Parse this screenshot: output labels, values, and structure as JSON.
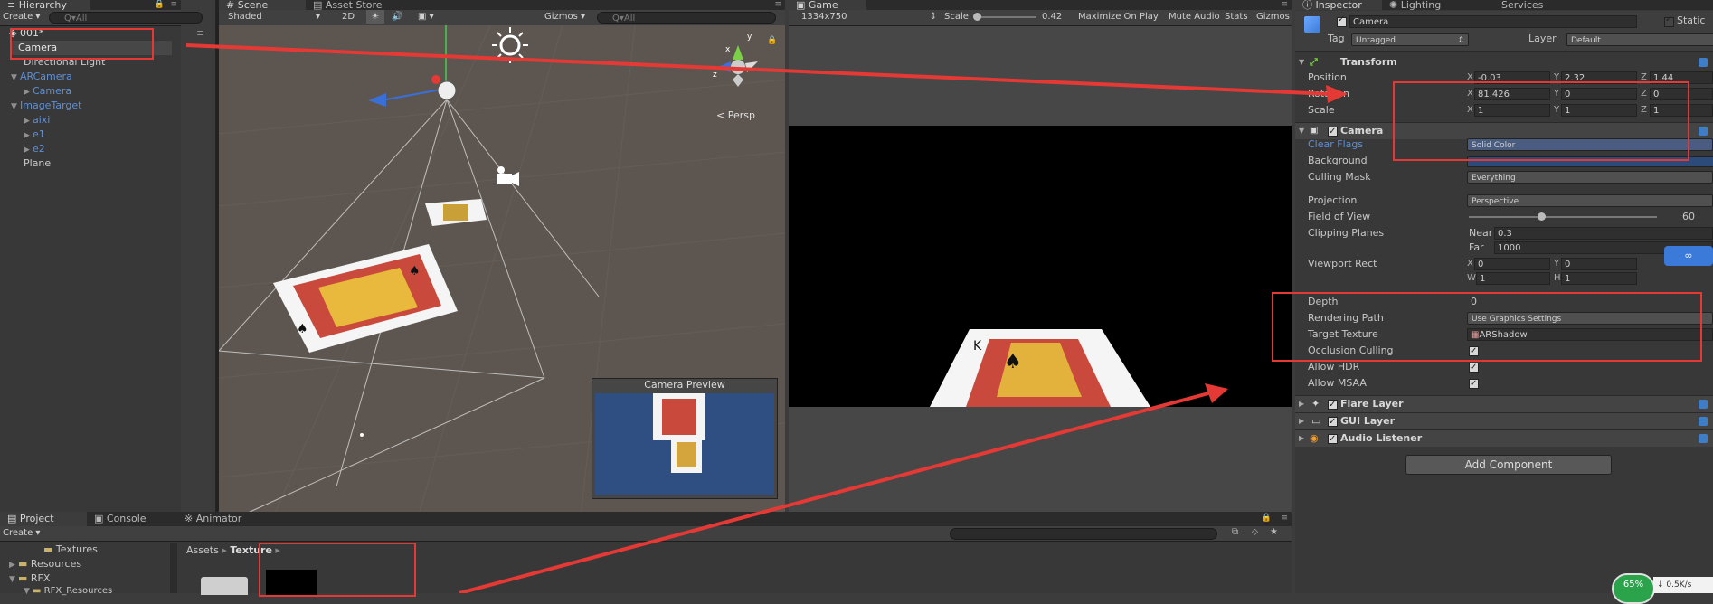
{
  "hierarchy": {
    "tab": "Hierarchy",
    "create": "Create",
    "search_placeholder": "Q▾All",
    "scene_name": "001*",
    "items": [
      {
        "label": "Camera",
        "indent": 1,
        "color": "white",
        "expand": ""
      },
      {
        "label": "Directional Light",
        "indent": 1,
        "color": "white",
        "expand": ""
      },
      {
        "label": "ARCamera",
        "indent": 0,
        "color": "blue",
        "expand": "▼"
      },
      {
        "label": "Camera",
        "indent": 1,
        "color": "blue",
        "expand": "▶"
      },
      {
        "label": "ImageTarget",
        "indent": 0,
        "color": "blue",
        "expand": "▼"
      },
      {
        "label": "aixi",
        "indent": 1,
        "color": "blue",
        "expand": "▶"
      },
      {
        "label": "e1",
        "indent": 1,
        "color": "blue",
        "expand": "▶"
      },
      {
        "label": "e2",
        "indent": 1,
        "color": "blue",
        "expand": "▶"
      },
      {
        "label": "Plane",
        "indent": 1,
        "color": "white",
        "expand": ""
      }
    ]
  },
  "scene": {
    "tabs": [
      "Scene",
      "Asset Store"
    ],
    "shading": "Shaded",
    "mode_2d": "2D",
    "gizmos": "Gizmos",
    "search_placeholder": "Q▾All",
    "persp": "Persp",
    "camera_preview": "Camera Preview",
    "gizmo_axes": [
      "y",
      "x",
      "z"
    ]
  },
  "game": {
    "tab": "Game",
    "resolution": "1334x750",
    "scale_label": "Scale",
    "scale_value": "0.42",
    "maximize": "Maximize On Play",
    "mute": "Mute Audio",
    "stats": "Stats",
    "gizmos": "Gizmos"
  },
  "inspector": {
    "tabs": [
      "Inspector",
      "Lighting",
      "Services"
    ],
    "object_name": "Camera",
    "static_label": "Static",
    "tag_label": "Tag",
    "tag_value": "Untagged",
    "layer_label": "Layer",
    "layer_value": "Default",
    "transform": {
      "title": "Transform",
      "position_label": "Position",
      "rotation_label": "Rotation",
      "scale_label": "Scale",
      "position": {
        "x": "-0.03",
        "y": "2.32",
        "z": "1.44"
      },
      "rotation": {
        "x": "81.426",
        "y": "0",
        "z": "0"
      },
      "scale": {
        "x": "1",
        "y": "1",
        "z": "1"
      }
    },
    "camera": {
      "title": "Camera",
      "clear_flags_label": "Clear Flags",
      "clear_flags_value": "Solid Color",
      "background_label": "Background",
      "background_color": "#2c4a7a",
      "culling_label": "Culling Mask",
      "culling_value": "Everything",
      "projection_label": "Projection",
      "projection_value": "Perspective",
      "fov_label": "Field of View",
      "fov_value": "60",
      "clipping_label": "Clipping Planes",
      "near_label": "Near",
      "near_value": "0.3",
      "far_label": "Far",
      "far_value": "1000",
      "viewport_label": "Viewport Rect",
      "viewport": {
        "x": "0",
        "y": "0",
        "w": "1",
        "h": "1"
      },
      "depth_label": "Depth",
      "depth_value": "0",
      "rendering_label": "Rendering Path",
      "rendering_value": "Use Graphics Settings",
      "target_label": "Target Texture",
      "target_value": "ARShadow",
      "occlusion_label": "Occlusion Culling",
      "hdr_label": "Allow HDR",
      "msaa_label": "Allow MSAA"
    },
    "components": [
      "Flare Layer",
      "GUI Layer",
      "Audio Listener"
    ],
    "add_component": "Add Component",
    "net_speed": "0.5K/s",
    "net_percent": "65%"
  },
  "project": {
    "tabs": [
      "Project",
      "Console",
      "Animator"
    ],
    "create": "Create",
    "folders": [
      "Textures",
      "Resources",
      "RFX",
      "RFX_Resources"
    ],
    "breadcrumb": [
      "Assets",
      "Texture"
    ]
  },
  "colors": {
    "highlight": "#e53935",
    "game_bg": "#000000",
    "preview_bg": "#2f4f82"
  }
}
